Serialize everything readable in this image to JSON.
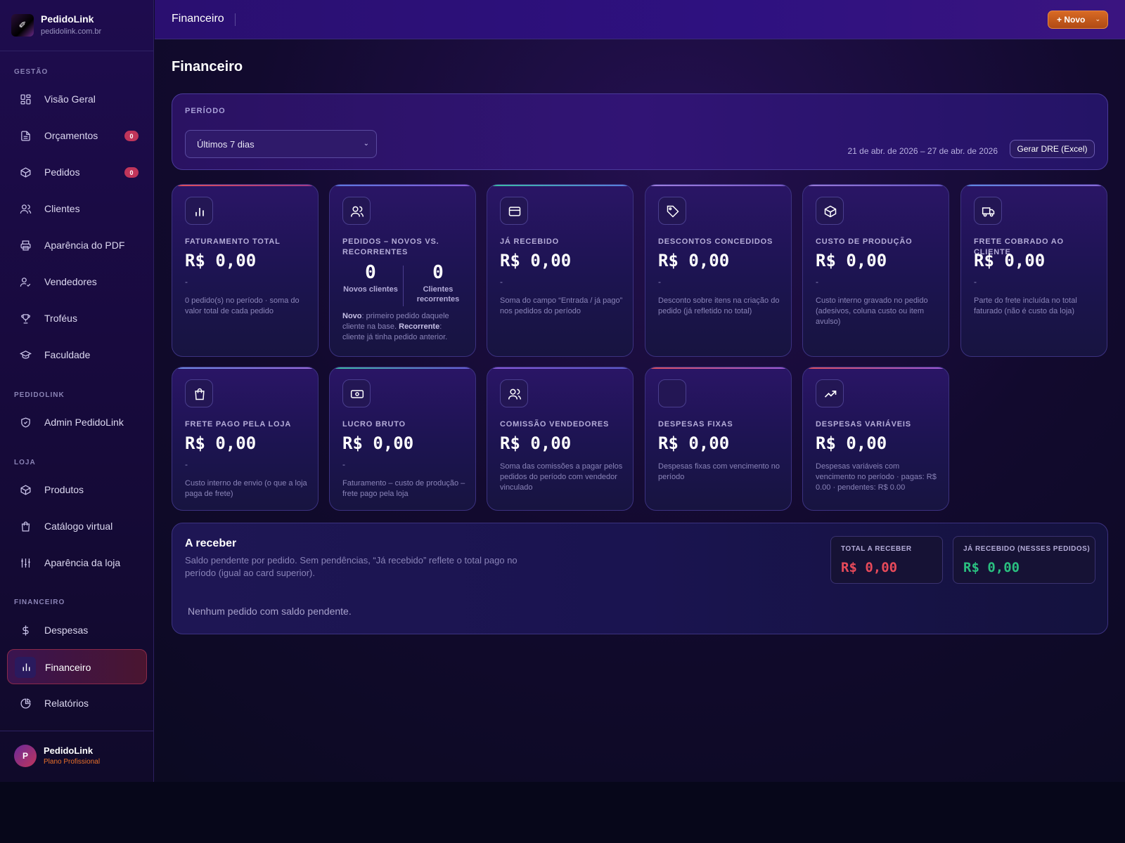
{
  "brand": {
    "name": "PedidoLink",
    "url": "pedidolink.com.br",
    "logo_glyph": "✐"
  },
  "sidebar": {
    "sections": {
      "gestao": "GESTÃO",
      "pedidolink": "PEDIDOLINK",
      "loja": "LOJA",
      "financeiro": "FINANCEIRO"
    },
    "items": [
      {
        "label": "Visão Geral",
        "icon": "grid-icon"
      },
      {
        "label": "Orçamentos",
        "icon": "document-icon",
        "badge": "0"
      },
      {
        "label": "Pedidos",
        "icon": "box-icon",
        "badge": "0"
      },
      {
        "label": "Clientes",
        "icon": "users-icon"
      },
      {
        "label": "Aparência do PDF",
        "icon": "printer-icon"
      },
      {
        "label": "Vendedores",
        "icon": "user-check-icon"
      },
      {
        "label": "Troféus",
        "icon": "trophy-icon"
      },
      {
        "label": "Faculdade",
        "icon": "graduation-cap-icon"
      },
      {
        "label": "Admin PedidoLink",
        "icon": "shield-icon"
      },
      {
        "label": "Produtos",
        "icon": "box-icon"
      },
      {
        "label": "Catálogo virtual",
        "icon": "shopping-bag-icon"
      },
      {
        "label": "Aparência da loja",
        "icon": "sliders-icon"
      },
      {
        "label": "Despesas",
        "icon": "dollar-icon"
      },
      {
        "label": "Financeiro",
        "icon": "bar-chart-icon",
        "active": true
      },
      {
        "label": "Relatórios",
        "icon": "pie-chart-icon"
      }
    ]
  },
  "user": {
    "initial": "P",
    "name": "PedidoLink",
    "plan": "Plano Profissional"
  },
  "topbar": {
    "title": "Financeiro",
    "new_label": "+ Novo"
  },
  "page": {
    "title": "Financeiro"
  },
  "period": {
    "label": "PERÍODO",
    "selected": "Últimos 7 dias",
    "range": "21 de abr. de 2026 – 27 de abr. de 2026",
    "dre_button": "Gerar DRE (Excel)"
  },
  "cards": [
    {
      "label": "FATURAMENTO TOTAL",
      "value": "R$ 0,00",
      "dash": "-",
      "desc": "0 pedido(s) no período · soma do valor total de cada pedido",
      "icon": "bar-chart-icon",
      "accent": "#e0505a"
    },
    {
      "label": "PEDIDOS – NOVOS VS. RECORRENTES",
      "icon": "users-icon",
      "accent": "#5a7ae0",
      "novos_num": "0",
      "novos_label": "Novos clientes",
      "rec_num": "0",
      "rec_label": "Clientes recorrentes",
      "note_novo": "Novo",
      "note_novo_text": ": primeiro pedido daquele cliente na base. ",
      "note_rec": "Recorrente",
      "note_rec_text": ": cliente já tinha pedido anterior."
    },
    {
      "label": "JÁ RECEBIDO",
      "value": "R$ 0,00",
      "dash": "-",
      "desc": "Soma do campo “Entrada / já pago” nos pedidos do período",
      "icon": "credit-card-icon",
      "accent": "#3ac0a0"
    },
    {
      "label": "DESCONTOS CONCEDIDOS",
      "value": "R$ 0,00",
      "dash": "-",
      "desc": "Desconto sobre itens na criação do pedido (já refletido no total)",
      "icon": "tag-icon",
      "accent": "#a080e0"
    },
    {
      "label": "CUSTO DE PRODUÇÃO",
      "value": "R$ 0,00",
      "dash": "-",
      "desc": "Custo interno gravado no pedido (adesivos, coluna custo ou item avulso)",
      "icon": "box-icon",
      "accent": "#9a7ad8"
    },
    {
      "label": "FRETE COBRADO AO CLIENTE",
      "value": "R$ 0,00",
      "dash": "-",
      "desc": "Parte do frete incluída no total faturado (não é custo da loja)",
      "icon": "truck-icon",
      "accent": "#5a8ae0"
    },
    {
      "label": "FRETE PAGO PELA LOJA",
      "value": "R$ 0,00",
      "dash": "-",
      "desc": "Custo interno de envio (o que a loja paga de frete)",
      "icon": "shopping-bag-icon",
      "accent": "#6a8ae0"
    },
    {
      "label": "LUCRO BRUTO",
      "value": "R$ 0,00",
      "dash": "-",
      "desc": "Faturamento – custo de produção – frete pago pela loja",
      "icon": "banknote-icon",
      "accent": "#3ac0a0"
    },
    {
      "label": "COMISSÃO VENDEDORES",
      "value": "R$ 0,00",
      "desc": "Soma das comissões a pagar pelos pedidos do período com vendedor vinculado",
      "icon": "users-icon",
      "accent": "#8a5ad8"
    },
    {
      "label": "DESPESAS FIXAS",
      "value": "R$ 0,00",
      "desc": "Despesas fixas com vencimento no período",
      "icon": "",
      "accent": "#e0505a"
    },
    {
      "label": "DESPESAS VARIÁVEIS",
      "value": "R$ 0,00",
      "desc": "Despesas variáveis com vencimento no período · pagas: R$ 0.00 · pendentes: R$ 0.00",
      "icon": "trending-up-icon",
      "accent": "#e0505a"
    }
  ],
  "receber": {
    "title": "A receber",
    "desc": "Saldo pendente por pedido. Sem pendências, “Já recebido” reflete o total pago no período (igual ao card superior).",
    "empty": "Nenhum pedido com saldo pendente.",
    "total_label": "TOTAL A RECEBER",
    "total_value": "R$ 0,00",
    "total_color": "#e84a5a",
    "recebido_label": "JÁ RECEBIDO (NESSES PEDIDOS)",
    "recebido_value": "R$ 0,00",
    "recebido_color": "#2ac080"
  }
}
